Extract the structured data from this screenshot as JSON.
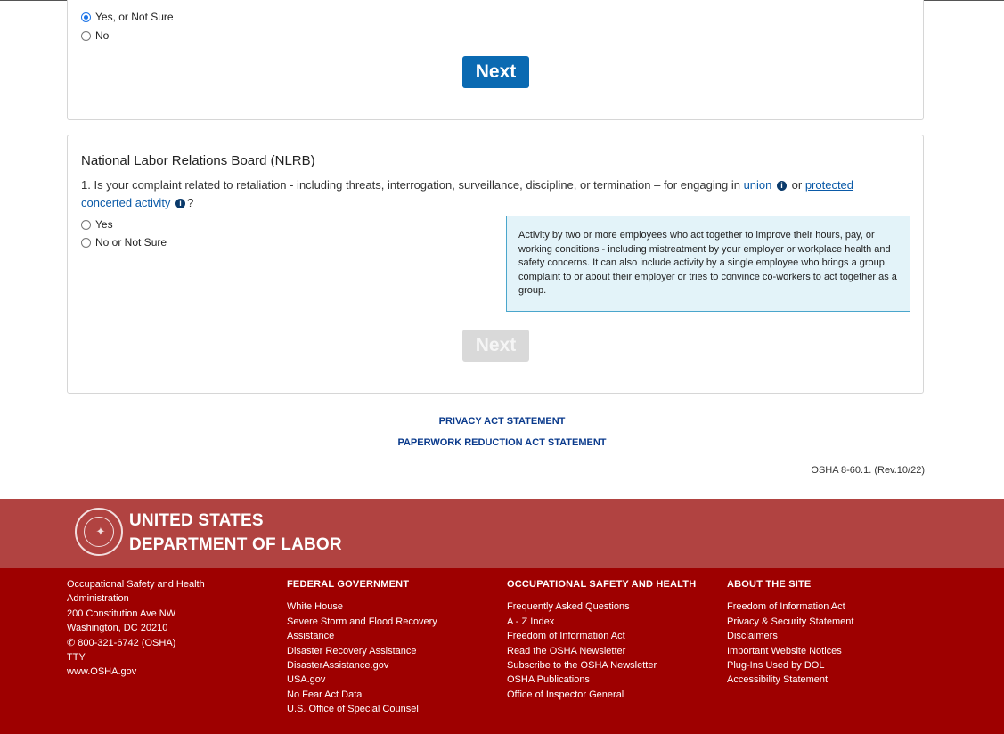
{
  "card1": {
    "options": [
      "Yes, or Not Sure",
      "No"
    ],
    "next_label": "Next"
  },
  "card2": {
    "title": "National Labor Relations Board (NLRB)",
    "question_start": "1. Is your complaint related to retaliation - including threats, interrogation, surveillance, discipline, or termination – for engaging in ",
    "link_union": "union",
    "question_or": " or ",
    "link_protected": "protected concerted activity",
    "question_end": "?",
    "info_glyph": "i",
    "options": [
      "Yes",
      "No or Not Sure"
    ],
    "tooltip": "Activity by two or more employees who act together to improve their hours, pay, or working conditions - including mistreatment by your employer or workplace health and safety concerns. It can also include activity by a single employee who brings a group complaint to or about their employer or tries to convince co-workers to act together as a group.",
    "next_label": "Next"
  },
  "statements": {
    "privacy": "PRIVACY ACT STATEMENT",
    "paperwork": "PAPERWORK REDUCTION ACT STATEMENT"
  },
  "version": "OSHA 8-60.1. (Rev.10/22)",
  "footer": {
    "dept_line1": "UNITED STATES",
    "dept_line2": "DEPARTMENT OF LABOR",
    "address": {
      "lines": [
        "Occupational Safety and Health",
        "Administration",
        "200 Constitution Ave NW",
        "Washington, DC 20210"
      ],
      "phone": "800-321-6742 (OSHA)",
      "tty": "TTY",
      "website": "www.OSHA.gov"
    },
    "federal": {
      "heading": "FEDERAL GOVERNMENT",
      "items": [
        "White House",
        "Severe Storm and Flood Recovery Assistance",
        "Disaster Recovery Assistance",
        "DisasterAssistance.gov",
        "USA.gov",
        "No Fear Act Data",
        "U.S. Office of Special Counsel"
      ]
    },
    "osh": {
      "heading": "OCCUPATIONAL SAFETY AND HEALTH",
      "items": [
        "Frequently Asked Questions",
        "A - Z Index",
        "Freedom of Information Act",
        "Read the OSHA Newsletter",
        "Subscribe to the OSHA Newsletter",
        "OSHA Publications",
        "Office of Inspector General"
      ]
    },
    "about": {
      "heading": "ABOUT THE SITE",
      "items": [
        "Freedom of Information Act",
        "Privacy & Security Statement",
        "Disclaimers",
        "Important Website Notices",
        "Plug-Ins Used by DOL",
        "Accessibility Statement"
      ]
    }
  },
  "colors": {
    "primary_button": "#0a6ab2",
    "footer_top": "#b14341",
    "footer_bottom": "#9e0000",
    "tooltip_bg": "#e3f3f9"
  }
}
